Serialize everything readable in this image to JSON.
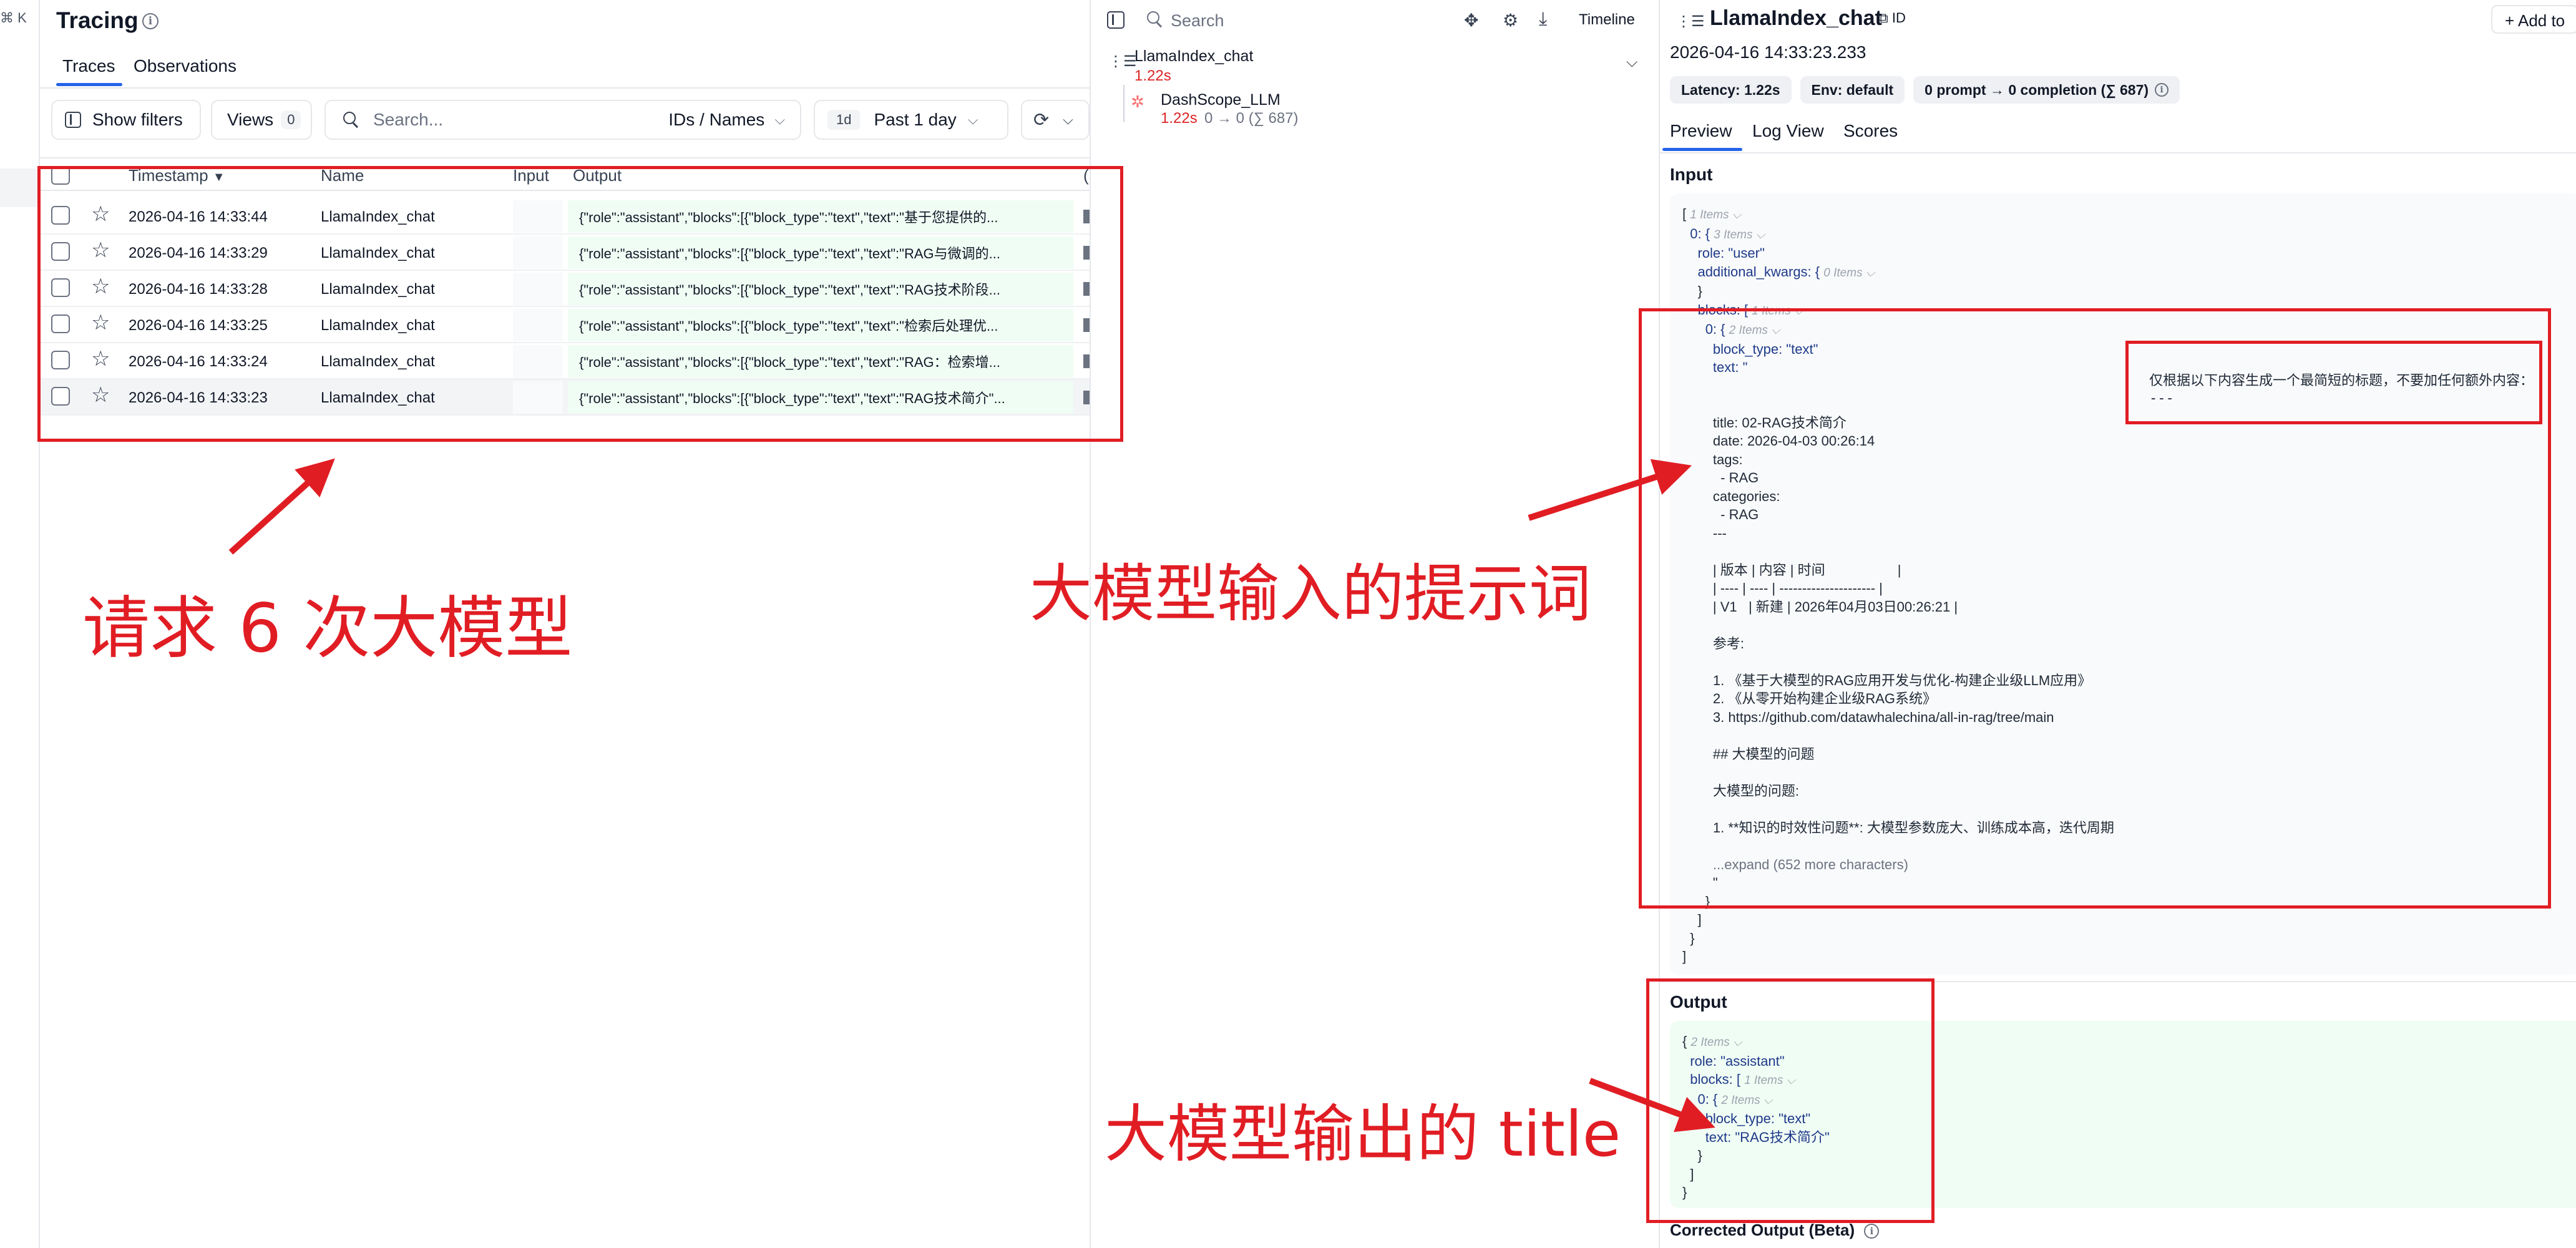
{
  "shortcut_hint": "⌘ K",
  "left": {
    "title": "Tracing",
    "tabs": [
      "Traces",
      "Observations"
    ],
    "toolbar": {
      "show_filters": "Show filters",
      "views_label": "Views",
      "views_count": "0",
      "search_placeholder": "Search...",
      "search_scope": "IDs / Names",
      "range_short": "1d",
      "range_label": "Past 1 day"
    },
    "columns": [
      "Timestamp",
      "Name",
      "Input",
      "Output"
    ],
    "rows": [
      {
        "timestamp": "2026-04-16 14:33:44",
        "name": "LlamaIndex_chat",
        "output": "{\"role\":\"assistant\",\"blocks\":[{\"block_type\":\"text\",\"text\":\"基于您提供的..."
      },
      {
        "timestamp": "2026-04-16 14:33:29",
        "name": "LlamaIndex_chat",
        "output": "{\"role\":\"assistant\",\"blocks\":[{\"block_type\":\"text\",\"text\":\"RAG与微调的..."
      },
      {
        "timestamp": "2026-04-16 14:33:28",
        "name": "LlamaIndex_chat",
        "output": "{\"role\":\"assistant\",\"blocks\":[{\"block_type\":\"text\",\"text\":\"RAG技术阶段..."
      },
      {
        "timestamp": "2026-04-16 14:33:25",
        "name": "LlamaIndex_chat",
        "output": "{\"role\":\"assistant\",\"blocks\":[{\"block_type\":\"text\",\"text\":\"检索后处理优..."
      },
      {
        "timestamp": "2026-04-16 14:33:24",
        "name": "LlamaIndex_chat",
        "output": "{\"role\":\"assistant\",\"blocks\":[{\"block_type\":\"text\",\"text\":\"RAG：检索增..."
      },
      {
        "timestamp": "2026-04-16 14:33:23",
        "name": "LlamaIndex_chat",
        "output": "{\"role\":\"assistant\",\"blocks\":[{\"block_type\":\"text\",\"text\":\"RAG技术简介\"..."
      }
    ]
  },
  "middle": {
    "search_placeholder": "Search",
    "timeline_label": "Timeline",
    "trace": {
      "name": "LlamaIndex_chat",
      "latency": "1.22s"
    },
    "observation": {
      "name": "DashScope_LLM",
      "latency": "1.22s",
      "tokens": "0 → 0 (∑ 687)"
    }
  },
  "right": {
    "title": "LlamaIndex_chat",
    "id_label": "ID",
    "add_label": "+ Add to",
    "timestamp": "2026-04-16 14:33:23.233",
    "chips": [
      "Latency: 1.22s",
      "Env: default",
      "0 prompt → 0 completion (∑ 687)"
    ],
    "tabs": [
      "Preview",
      "Log View",
      "Scores"
    ],
    "input_heading": "Input",
    "output_heading": "Output",
    "corrected_heading": "Corrected Output (Beta)",
    "input_json": {
      "l1": "[",
      "l1_meta": "1 Items",
      "l2": "0: {",
      "l2_meta": "3 Items",
      "l3": "role: \"user\"",
      "l4": "additional_kwargs: {",
      "l4_meta": "0 Items",
      "l5": "}",
      "l6": "blocks: [",
      "l6_meta": "1 Items",
      "l7": "0: {",
      "l7_meta": "2 Items",
      "l8": "block_type: \"text\"",
      "l9": "text: \"",
      "l10": "title: 02-RAG技术简介",
      "l11": "date: 2026-04-03 00:26:14",
      "l12": "tags:",
      "l13": "  - RAG",
      "l14": "categories:",
      "l15": "  - RAG",
      "l16": "---",
      "l17": "| 版本 | 内容 | 时间                   |",
      "l18": "| ---- | ---- | --------------------- |",
      "l19": "| V1   | 新建 | 2026年04月03日00:26:21 |",
      "l20": "参考:",
      "l21": "1. 《基于大模型的RAG应用开发与优化-构建企业级LLM应用》",
      "l22": "2. 《从零开始构建企业级RAG系统》",
      "l23": "3. https://github.com/datawhalechina/all-in-rag/tree/main",
      "l24": "## 大模型的问题",
      "l25": "大模型的问题:",
      "l26": "1. **知识的时效性问题**: 大模型参数庞大、训练成本高，迭代周期",
      "l27": "...expand (652 more characters)",
      "l28": "\"",
      "l29": "}",
      "l30": "]",
      "l31": "}",
      "l32": "]",
      "inline_prompt_1": "仅根据以下内容生成一个最简短的标题，不要加任何额外内容：",
      "inline_prompt_2": "---"
    },
    "output_json": {
      "l1": "{",
      "l1_meta": "2 Items",
      "l2": "role: \"assistant\"",
      "l3": "blocks: [",
      "l3_meta": "1 Items",
      "l4": "0: {",
      "l4_meta": "2 Items",
      "l5": "block_type: \"text\"",
      "l6": "text: \"RAG技术简介\"",
      "l7": "}",
      "l8": "]",
      "l9": "}"
    }
  },
  "annotations": {
    "left": "请求 6 次大模型",
    "input": "大模型输入的提示词",
    "output": "大模型输出的 title"
  },
  "colors": {
    "annotation_red": "#e11d24",
    "accent_blue": "#2563eb",
    "latency_red": "#dc2626",
    "output_bg": "#f0fdf4"
  }
}
